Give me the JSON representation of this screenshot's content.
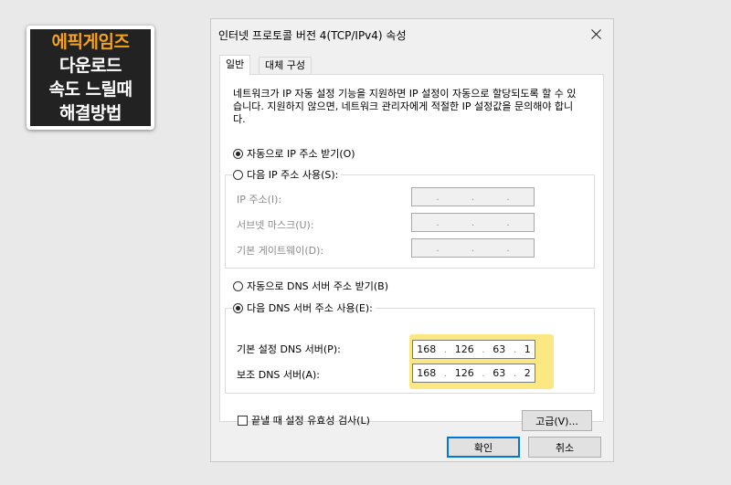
{
  "overlay": {
    "lines": [
      "에픽게임즈",
      "다운로드",
      "속도 느릴때",
      "해결방법"
    ]
  },
  "dialog": {
    "title": "인터넷 프로토콜 버전 4(TCP/IPv4) 속성",
    "close_glyph": "✕",
    "tabs": [
      "일반",
      "대체 구성"
    ],
    "description": "네트워크가 IP 자동 설정 기능을 지원하면 IP 설정이 자동으로 할당되도록 할 수 있습니다. 지원하지 않으면, 네트워크 관리자에게 적절한 IP 설정값을 문의해야 합니다.",
    "ip": {
      "auto_label": "자동으로 IP 주소 받기(O)",
      "auto_selected": true,
      "manual_label": "다음 IP 주소 사용(S):",
      "manual_selected": false,
      "fields": [
        {
          "label": "IP 주소(I):",
          "octets": [
            "",
            "",
            "",
            ""
          ]
        },
        {
          "label": "서브넷 마스크(U):",
          "octets": [
            "",
            "",
            "",
            ""
          ]
        },
        {
          "label": "기본 게이트웨이(D):",
          "octets": [
            "",
            "",
            "",
            ""
          ]
        }
      ]
    },
    "dns": {
      "auto_label": "자동으로 DNS 서버 주소 받기(B)",
      "auto_selected": false,
      "manual_label": "다음 DNS 서버 주소 사용(E):",
      "manual_selected": true,
      "fields": [
        {
          "label": "기본 설정 DNS 서버(P):",
          "octets": [
            "168",
            "126",
            "63",
            "1"
          ]
        },
        {
          "label": "보조 DNS 서버(A):",
          "octets": [
            "168",
            "126",
            "63",
            "2"
          ]
        }
      ]
    },
    "validate_label": "끝낼 때 설정 유효성 검사(L)",
    "validate_checked": false,
    "advanced_button": "고급(V)...",
    "ok_button": "확인",
    "cancel_button": "취소"
  },
  "colors": {
    "highlight": "#fbe883",
    "badge_accent": "#f4a21c",
    "default_button_border": "#0078d7"
  }
}
